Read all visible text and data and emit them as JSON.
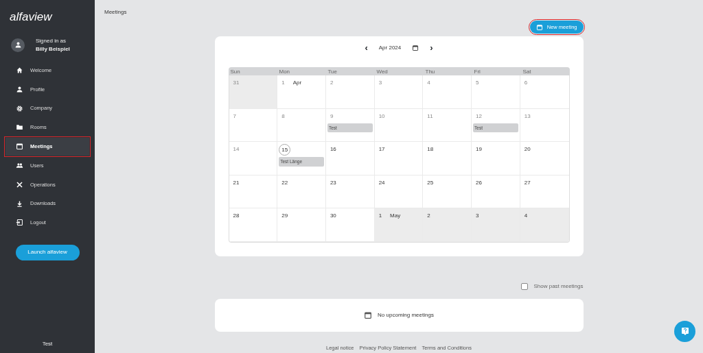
{
  "sidebar": {
    "logo": "alfaview",
    "user": {
      "caption": "Signed in as",
      "name": "Billy Beispiel"
    },
    "items": [
      {
        "label": "Welcome",
        "selected": false,
        "highlighted": false
      },
      {
        "label": "Profile",
        "selected": false,
        "highlighted": false
      },
      {
        "label": "Company",
        "selected": false,
        "highlighted": false
      },
      {
        "label": "Rooms",
        "selected": false,
        "highlighted": false
      },
      {
        "label": "Meetings",
        "selected": true,
        "highlighted": true
      },
      {
        "label": "Users",
        "selected": false,
        "highlighted": false
      },
      {
        "label": "Operations",
        "selected": false,
        "highlighted": false
      },
      {
        "label": "Downloads",
        "selected": false,
        "highlighted": false
      },
      {
        "label": "Logout",
        "selected": false,
        "highlighted": false
      }
    ],
    "launch_button": "Launch alfaview",
    "footer": "Test"
  },
  "page_title": "Meetings",
  "new_meeting_button": {
    "label": "New meeting",
    "highlighted": true
  },
  "calendar": {
    "month": "Apr 2024",
    "prev": "‹",
    "next": "›",
    "weekdays": [
      "Sun",
      "Mon",
      "Tue",
      "Wed",
      "Thu",
      "Fri",
      "Sat"
    ],
    "weeks": [
      [
        {
          "day": "31",
          "outside": true,
          "past": true
        },
        {
          "day": "1",
          "month": "Apr",
          "outside": false,
          "past": true
        },
        {
          "day": "2",
          "outside": false,
          "past": true
        },
        {
          "day": "3",
          "outside": false,
          "past": true
        },
        {
          "day": "4",
          "outside": false,
          "past": true
        },
        {
          "day": "5",
          "outside": false,
          "past": true
        },
        {
          "day": "6",
          "outside": false,
          "past": true
        }
      ],
      [
        {
          "day": "7",
          "outside": false,
          "past": true
        },
        {
          "day": "8",
          "outside": false,
          "past": true
        },
        {
          "day": "9",
          "outside": false,
          "past": true,
          "events": [
            "Test"
          ]
        },
        {
          "day": "10",
          "outside": false,
          "past": true
        },
        {
          "day": "11",
          "outside": false,
          "past": true
        },
        {
          "day": "12",
          "outside": false,
          "past": true,
          "events": [
            "Test"
          ]
        },
        {
          "day": "13",
          "outside": false,
          "past": true
        }
      ],
      [
        {
          "day": "14",
          "outside": false,
          "past": true
        },
        {
          "day": "15",
          "outside": false,
          "past": false,
          "today": true,
          "events": [
            "Test Länge"
          ]
        },
        {
          "day": "16",
          "outside": false,
          "past": false
        },
        {
          "day": "17",
          "outside": false,
          "past": false
        },
        {
          "day": "18",
          "outside": false,
          "past": false
        },
        {
          "day": "19",
          "outside": false,
          "past": false
        },
        {
          "day": "20",
          "outside": false,
          "past": false
        }
      ],
      [
        {
          "day": "21",
          "outside": false,
          "past": false
        },
        {
          "day": "22",
          "outside": false,
          "past": false
        },
        {
          "day": "23",
          "outside": false,
          "past": false
        },
        {
          "day": "24",
          "outside": false,
          "past": false
        },
        {
          "day": "25",
          "outside": false,
          "past": false
        },
        {
          "day": "26",
          "outside": false,
          "past": false
        },
        {
          "day": "27",
          "outside": false,
          "past": false
        }
      ],
      [
        {
          "day": "28",
          "outside": false,
          "past": false
        },
        {
          "day": "29",
          "outside": false,
          "past": false
        },
        {
          "day": "30",
          "outside": false,
          "past": false
        },
        {
          "day": "1",
          "month": "May",
          "outside": true,
          "past": false
        },
        {
          "day": "2",
          "outside": true,
          "past": false
        },
        {
          "day": "3",
          "outside": true,
          "past": false
        },
        {
          "day": "4",
          "outside": true,
          "past": false
        }
      ]
    ]
  },
  "show_past": {
    "label": "Show past meetings",
    "checked": false
  },
  "empty_message": "No upcoming meetings",
  "footer_links": [
    "Legal notice",
    "Privacy Policy Statement",
    "Terms and Conditions"
  ]
}
